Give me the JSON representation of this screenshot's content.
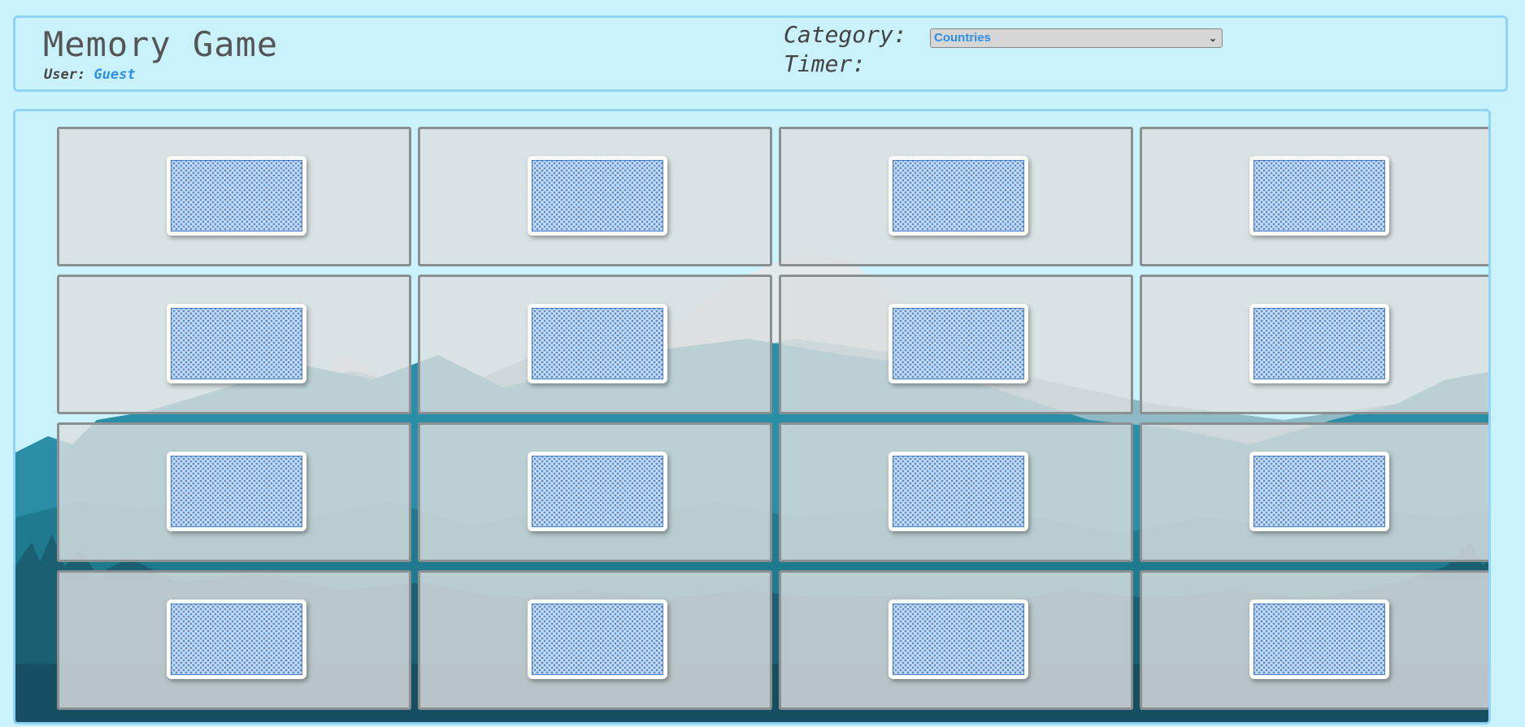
{
  "header": {
    "title": "Memory Game",
    "user_label": "User:",
    "user_name": "Guest",
    "category_label": "Category:",
    "category_value": "Countries",
    "timer_label": "Timer:"
  },
  "board": {
    "rows": 4,
    "columns": 4,
    "card_state": "face-down",
    "card_count": 16
  },
  "colors": {
    "accent": "#2b8ee8",
    "background": "#caf2fc",
    "panel_border": "#8fd3f6",
    "card_back": "#5b8fd0"
  }
}
